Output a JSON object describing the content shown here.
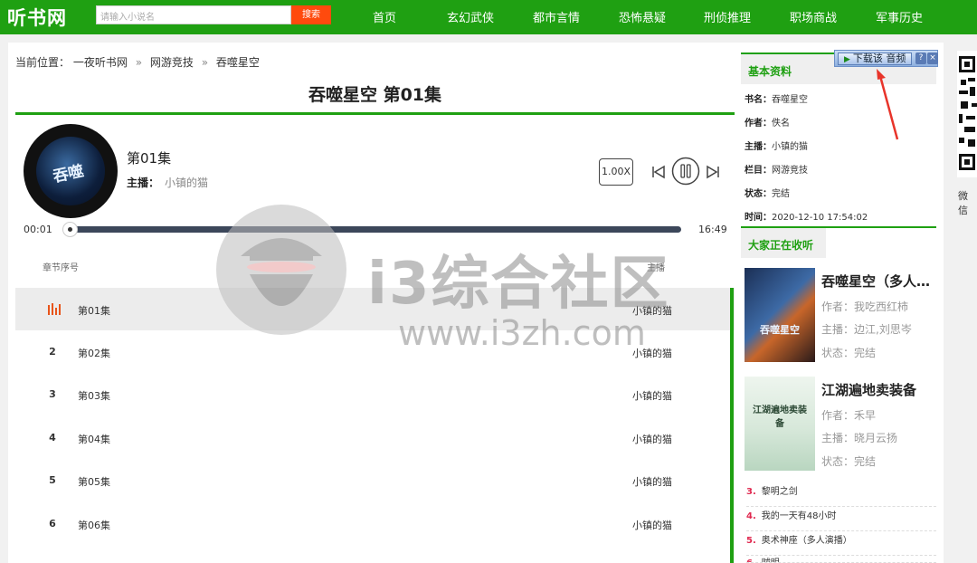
{
  "site": {
    "logo": "听书网"
  },
  "search": {
    "placeholder": "请输入小说名",
    "button_label": "搜索"
  },
  "nav": [
    "首页",
    "玄幻武侠",
    "都市言情",
    "恐怖悬疑",
    "刑侦推理",
    "职场商战",
    "军事历史"
  ],
  "breadcrumb": {
    "label": "当前位置：",
    "items": [
      "一夜听书网",
      "网游竞技",
      "吞噬星空"
    ],
    "sep": "»"
  },
  "player": {
    "page_title": "吞噬星空 第01集",
    "episode": "第01集",
    "host_label": "主播：",
    "host": "小镇的猫",
    "speed": "1.00X",
    "current_time": "00:01",
    "total_time": "16:49",
    "progress": 0.001
  },
  "list": {
    "col_index": "章节序号",
    "col_host": "主播",
    "rows": [
      {
        "index": "",
        "name": "第01集",
        "host": "小镇的猫",
        "playing": true
      },
      {
        "index": "2",
        "name": "第02集",
        "host": "小镇的猫",
        "playing": false
      },
      {
        "index": "3",
        "name": "第03集",
        "host": "小镇的猫",
        "playing": false
      },
      {
        "index": "4",
        "name": "第04集",
        "host": "小镇的猫",
        "playing": false
      },
      {
        "index": "5",
        "name": "第05集",
        "host": "小镇的猫",
        "playing": false
      },
      {
        "index": "6",
        "name": "第06集",
        "host": "小镇的猫",
        "playing": false
      }
    ]
  },
  "info": {
    "heading": "基本资料",
    "book_label": "书名：",
    "book": "吞噬星空",
    "author_label": "作者：",
    "author": "佚名",
    "host_label": "主播：",
    "host": "小镇的猫",
    "column_label": "栏目：",
    "column": "网游竞技",
    "status_label": "状态：",
    "status": "完结",
    "time_label": "时间：",
    "time": "2020-12-10 17:54:02"
  },
  "popular": {
    "heading": "大家正在收听",
    "books": [
      {
        "title": "吞噬星空（多人…",
        "author_label": "作者：",
        "author": "我吃西红柿",
        "host_label": "主播：",
        "host": "边江,刘思岑",
        "status_label": "状态：",
        "status": "完结",
        "cover_text": "吞噬星空"
      },
      {
        "title": "江湖遍地卖装备",
        "author_label": "作者：",
        "author": "禾早",
        "host_label": "主播：",
        "host": "晓月云扬",
        "status_label": "状态：",
        "status": "完结",
        "cover_text": "江湖遍地卖装备"
      }
    ],
    "ranks": [
      {
        "n": "3.",
        "title": "黎明之剑"
      },
      {
        "n": "4.",
        "title": "我的一天有48小时"
      },
      {
        "n": "5.",
        "title": "奥术神座（多人演播）"
      },
      {
        "n": "6.",
        "title": "贼明"
      }
    ]
  },
  "download_bar": {
    "label": "下载该 音频",
    "help": "?",
    "close": "×"
  },
  "qr": {
    "label": "微信"
  },
  "watermark": {
    "title": "i3综合社区",
    "url": "www.i3zh.com"
  },
  "colors": {
    "brand": "#1fa012",
    "search_button": "#ff4a0d",
    "rank_number": "#e0284f",
    "playing": "#e8541a"
  }
}
